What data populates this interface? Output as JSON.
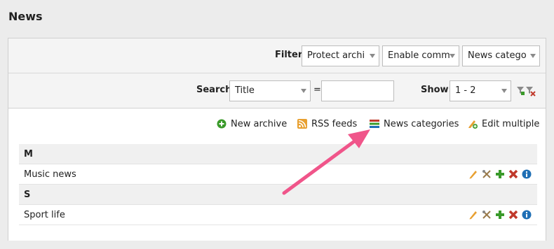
{
  "page": {
    "title": "News"
  },
  "filter": {
    "label": "Filter:",
    "selects": [
      "Protect archi",
      "Enable comm",
      "News catego"
    ]
  },
  "search": {
    "label": "Search:",
    "field_value": "Title",
    "operator": "=",
    "value": "",
    "show_label": "Show:",
    "show_value": "1 - 2"
  },
  "actions": [
    {
      "label": "New archive",
      "icon": "plus-circle-icon"
    },
    {
      "label": "RSS feeds",
      "icon": "rss-icon"
    },
    {
      "label": "News categories",
      "icon": "categories-icon"
    },
    {
      "label": "Edit multiple",
      "icon": "edit-multiple-icon"
    }
  ],
  "table": {
    "groups": [
      {
        "letter": "M",
        "items": [
          "Music news"
        ]
      },
      {
        "letter": "S",
        "items": [
          "Sport life"
        ]
      }
    ]
  },
  "colors": {
    "accent_arrow": "#f0558a",
    "green": "#3a9a2a",
    "red": "#c0392b",
    "blue": "#1f6fb5",
    "orange": "#e8a030"
  }
}
